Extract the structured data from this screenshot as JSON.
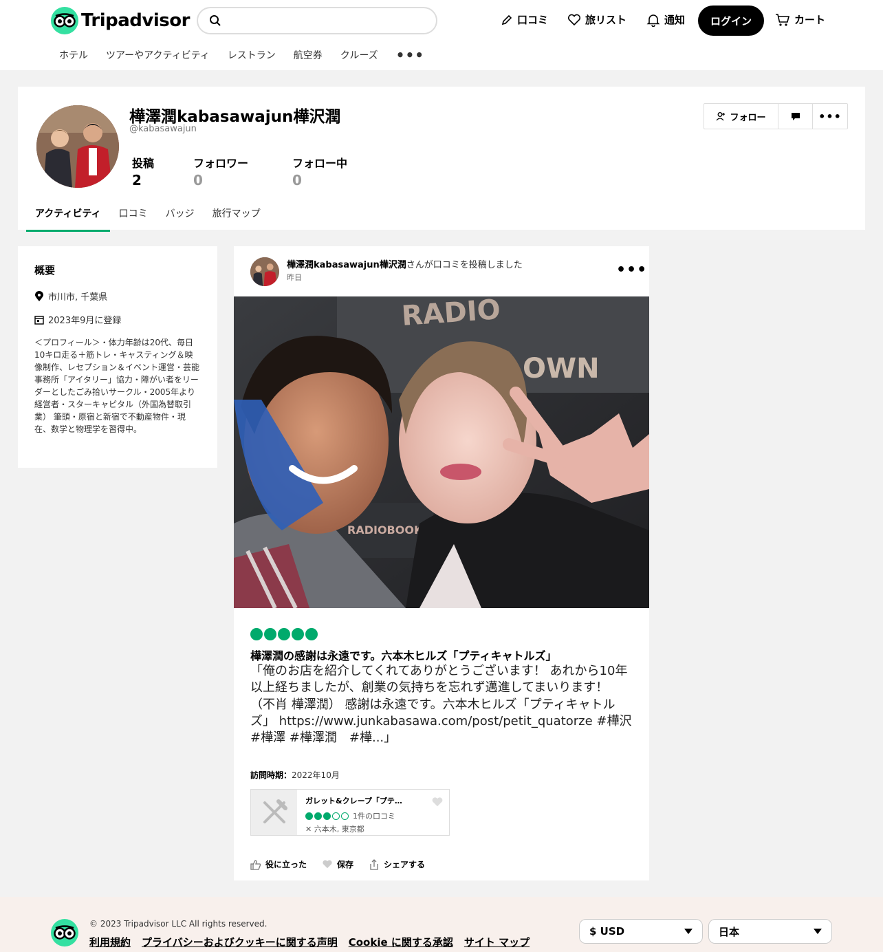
{
  "header": {
    "brand": "Tripadvisor",
    "search_placeholder": "",
    "nav": {
      "review": "口コミ",
      "trips": "旅リスト",
      "alerts": "通知",
      "login": "ログイン",
      "cart": "カート"
    },
    "categories": [
      "ホテル",
      "ツアーやアクティビティ",
      "レストラン",
      "航空券",
      "クルーズ"
    ]
  },
  "profile": {
    "name": "樺澤潤kabasawajun樺沢潤",
    "handle": "@kabasawajun",
    "stats": [
      {
        "label": "投稿",
        "value": "2"
      },
      {
        "label": "フォロワー",
        "value": "0"
      },
      {
        "label": "フォロー中",
        "value": "0"
      }
    ],
    "follow_label": "フォロー",
    "tabs": [
      "アクティビティ",
      "口コミ",
      "バッジ",
      "旅行マップ"
    ]
  },
  "intro": {
    "title": "概要",
    "location": "市川市, 千葉県",
    "joined": "2023年9月に登録",
    "bio": "＜プロフィール＞・体力年齢は20代、毎日10キロ走る＋筋トレ・キャスティング＆映像制作、レセプション＆イベント運営・芸能事務所「アイタリー」協力・障がい者をリーダーとしたごみ拾いサークル・2005年より経営者・スターキャピタル（外国為替取引業） 筆頭・原宿と新宿で不動産物件・現在、数学と物理学を習得中。"
  },
  "post": {
    "author": "樺澤潤kabasawajun樺沢潤",
    "action": "さんが口コミを投稿しました",
    "time": "昨日",
    "rating": 5,
    "title": "樺澤潤の感謝は永遠です。六本木ヒルズ「プティキャトルズ」",
    "body": "「俺のお店を紹介してくれてありがとうございます！ あれから10年以上経ちましたが、創業の気持ちを忘れず邁進してまいります！ （不肖 樺澤潤） 感謝は永遠です。六本木ヒルズ「プティキャトルズ」 https://www.junkabasawa.com/post/petit_quatorze #樺沢 #樺澤 #樺澤潤　#樺...」",
    "visit_label": "訪問時期：",
    "visit_value": "2022年10月",
    "photo_signs": {
      "top": "RADIO",
      "side": "OWN",
      "board": "RADIOBOOK"
    },
    "place": {
      "name": "ガレット&クレープ「プテ…",
      "rating": 3,
      "reviews": "1件の口コミ",
      "location": "六本木, 東京都"
    },
    "actions": {
      "helpful": "役に立った",
      "save": "保存",
      "share": "シェアする"
    }
  },
  "footer": {
    "copyright": "© 2023 Tripadvisor LLC All rights reserved.",
    "links": [
      "利用規約",
      "プライバシーおよびクッキーに関する声明",
      "Cookie に関する承認",
      "サイト マップ"
    ],
    "currency": "$ USD",
    "region": "日本"
  },
  "colors": {
    "accent": "#00aa6c",
    "owl": "#34e0a1",
    "footer_bg": "#f8f0ec"
  },
  "icons": [
    "search-icon",
    "pencil-icon",
    "heart-icon",
    "bell-icon",
    "cart-icon",
    "pin-icon",
    "calendar-icon",
    "add-user-icon",
    "message-icon",
    "more-icon",
    "thumbs-up-icon",
    "share-icon",
    "utensils-icon",
    "chevron-down-icon"
  ]
}
